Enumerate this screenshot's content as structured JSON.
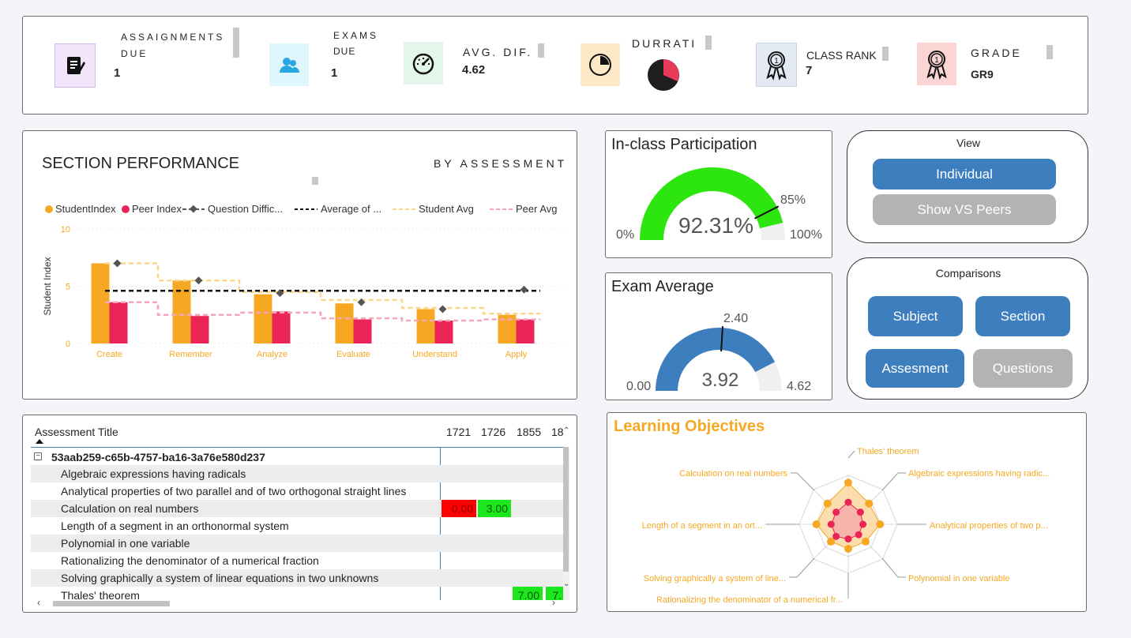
{
  "kpis": {
    "assignments": {
      "label1": "ASSAIGNMENTS",
      "label2": "DUE",
      "value": "1"
    },
    "exams": {
      "label1": "EXAMS",
      "label2": "DUE",
      "value": "1"
    },
    "avg_dif": {
      "label": "AVG. DIF.",
      "value": "4.62"
    },
    "durrati": {
      "label": "DURRATI"
    },
    "class_rank": {
      "label": "CLASS RANK",
      "value": "7"
    },
    "grade": {
      "label": "GRADE",
      "value": "GR9"
    }
  },
  "section_performance": {
    "title": "SECTION PERFORMANCE",
    "subtitle": "BY ASSESSMENT",
    "legend": [
      "StudentIndex",
      "Peer Index",
      "Question Diffic...",
      "Average of ...",
      "Student Avg",
      "Peer Avg"
    ],
    "colors": {
      "student": "#f7a823",
      "peer": "#ea2456",
      "diff": "#555555",
      "avg": "#111111",
      "student_avg": "#fbd58a",
      "peer_avg": "#f4a7b9"
    }
  },
  "chart_data": {
    "type": "bar",
    "ylabel": "Student Index",
    "ylim": [
      0,
      10
    ],
    "yticks": [
      "0",
      "5",
      "10"
    ],
    "categories": [
      "Create",
      "Remember",
      "Analyze",
      "Evaluate",
      "Understand",
      "Apply"
    ],
    "series": [
      {
        "name": "StudentIndex",
        "type": "bar",
        "values": [
          7.0,
          5.5,
          4.3,
          3.5,
          3.0,
          2.5
        ]
      },
      {
        "name": "Peer Index",
        "type": "bar",
        "values": [
          3.6,
          2.4,
          2.8,
          2.1,
          2.0,
          2.1
        ]
      },
      {
        "name": "Question Diffic...",
        "type": "points",
        "values": [
          7.0,
          5.5,
          4.4,
          3.6,
          3.0,
          4.7
        ]
      },
      {
        "name": "Average of ...",
        "type": "line",
        "values": [
          4.6,
          4.6,
          4.6,
          4.6,
          4.6,
          4.6
        ]
      },
      {
        "name": "Student Avg",
        "type": "step",
        "values": [
          7.0,
          5.5,
          4.5,
          3.8,
          3.1,
          2.6
        ]
      },
      {
        "name": "Peer Avg",
        "type": "step",
        "values": [
          3.6,
          2.5,
          2.7,
          2.2,
          2.0,
          2.1
        ]
      }
    ]
  },
  "participation": {
    "title": "In-class Participation",
    "value": "92.31%",
    "target": "85%",
    "min": "0%",
    "max": "100%",
    "fraction": 0.9231,
    "target_fraction": 0.85,
    "color": "#2ee60f"
  },
  "exam_average": {
    "title": "Exam Average",
    "value": "3.92",
    "target": "2.40",
    "min": "0.00",
    "max": "4.62",
    "fraction": 0.8485,
    "target_fraction": 0.5195,
    "color": "#3d7ebf"
  },
  "view": {
    "title": "View",
    "individual": "Individual",
    "vs_peers": "Show VS Peers"
  },
  "comparisons": {
    "title": "Comparisons",
    "subject": "Subject",
    "section": "Section",
    "assesment": "Assesment",
    "questions": "Questions"
  },
  "table": {
    "header": "Assessment Title",
    "columns": [
      "1721",
      "1726",
      "1855",
      "18"
    ],
    "group": "53aab259-c65b-4757-ba16-3a76e580d237",
    "rows": [
      {
        "title": "Algebraic expressions having radicals",
        "c1": "",
        "c2": ""
      },
      {
        "title": "Analytical properties of two parallel and of two orthogonal straight lines",
        "c1": "",
        "c2": ""
      },
      {
        "title": "Calculation on real numbers",
        "c1": "0.00",
        "c2": "3.00"
      },
      {
        "title": "Length of a segment in an orthonormal system",
        "c1": "",
        "c2": ""
      },
      {
        "title": "Polynomial in one variable",
        "c1": "",
        "c2": ""
      },
      {
        "title": "Rationalizing the denominator of a numerical fraction",
        "c1": "",
        "c2": ""
      },
      {
        "title": "Solving graphically a system of linear equations in two unknowns",
        "c1": "",
        "c2": ""
      },
      {
        "title": "Thales' theorem",
        "c3": "7.00",
        "c4": "7."
      }
    ]
  },
  "learning_objectives": {
    "title": "Learning Objectives",
    "labels": [
      "Thales' theorem",
      "Algebraic expressions having radic...",
      "Analytical properties of two p...",
      "Polynomial in one variable",
      "Rationalizing the denominator of a numerical fr...",
      "Solving graphically a system of line...",
      "Length of a segment in an ort...",
      "Calculation on real numbers"
    ],
    "student": [
      0.85,
      0.6,
      0.65,
      0.5,
      0.5,
      0.5,
      0.65,
      0.6
    ],
    "peer": [
      0.45,
      0.35,
      0.3,
      0.3,
      0.3,
      0.35,
      0.35,
      0.35
    ]
  }
}
